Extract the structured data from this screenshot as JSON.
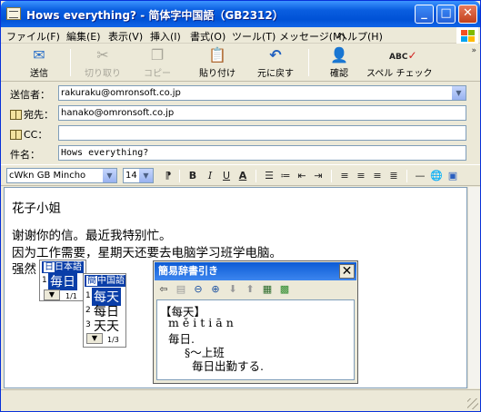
{
  "window": {
    "title": "Hows everything? - 简体字中国語（GB2312）"
  },
  "menu": {
    "items": [
      "ファイル(F)",
      "編集(E)",
      "表示(V)",
      "挿入(I)",
      "書式(O)",
      "ツール(T)",
      "メッセージ(M)",
      "ヘルプ(H)"
    ]
  },
  "toolbar": {
    "send": "送信",
    "cut": "切り取り",
    "copy": "コピー",
    "paste": "貼り付け",
    "undo": "元に戻す",
    "check": "確認",
    "spell": "スペル チェック"
  },
  "header": {
    "from_label": "送信者：",
    "from_value": "rakuraku@omronsoft.co.jp",
    "to_label": "宛先：",
    "to_value": "hanako@omronsoft.co.jp",
    "cc_label": "CC：",
    "cc_value": "",
    "subject_label": "件名：",
    "subject_value": "Hows everything?"
  },
  "format": {
    "font": "cWkn GB Mincho",
    "size": "14"
  },
  "body": {
    "line1": "花子小姐",
    "line2": "谢谢你的信。最近我特别忙。",
    "line3": "因为工作需要，星期天还要去电脑学习班学电脑。",
    "line4_prefix": "强然"
  },
  "ime1": {
    "icon": "日",
    "head": "日本語",
    "candidate": "毎日",
    "num": "1",
    "page": "1/1"
  },
  "ime2": {
    "icon": "簡",
    "head": "中国語",
    "candidates": [
      {
        "num": "1",
        "text": "每天"
      },
      {
        "num": "2",
        "text": "每日"
      },
      {
        "num": "3",
        "text": "天天"
      }
    ],
    "page": "1/3"
  },
  "dictionary": {
    "title": "簡易辞書引き",
    "headword": "【每天】",
    "pinyin": "měitiān",
    "meaning1": "毎日.",
    "example_cn": "§～上班",
    "example_jp": "毎日出勤する."
  },
  "colors": {
    "titlebar": "#0052d6",
    "selection": "#0a3ea8",
    "window_bg": "#ece9d8"
  }
}
